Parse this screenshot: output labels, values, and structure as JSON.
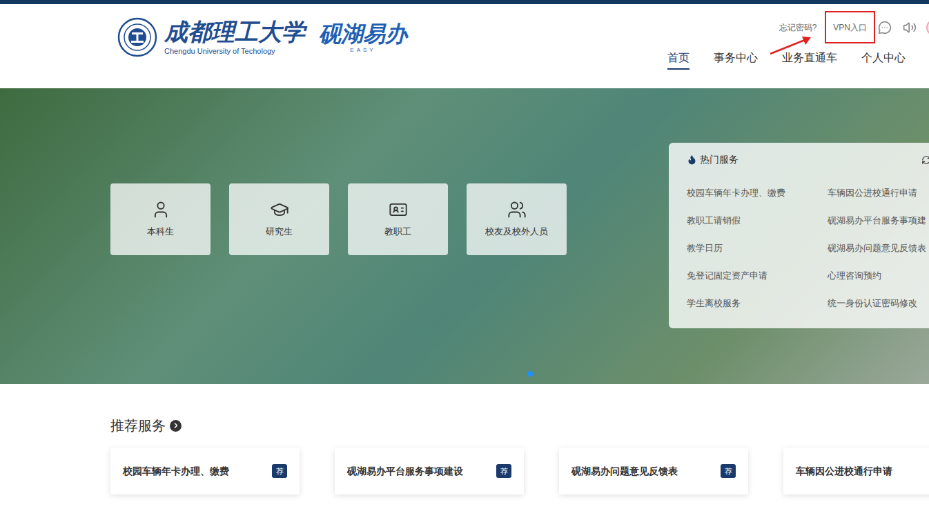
{
  "header": {
    "logo": {
      "school_cn": "成都理工大学",
      "school_en": "Chengdu University of Techology",
      "brand": "砚湖易办",
      "brand_sub": "EASY"
    },
    "top_links": {
      "forgot_password": "忘记密码?",
      "vpn": "VPN入口"
    },
    "nav": [
      {
        "label": "首页",
        "selected": true
      },
      {
        "label": "事务中心",
        "selected": false
      },
      {
        "label": "业务直通车",
        "selected": false
      },
      {
        "label": "个人中心",
        "selected": false
      }
    ]
  },
  "hero": {
    "user_types": [
      {
        "label": "本科生"
      },
      {
        "label": "研究生"
      },
      {
        "label": "教职工"
      },
      {
        "label": "校友及校外人员"
      }
    ],
    "hot_services": {
      "title": "热门服务",
      "items": [
        "校园车辆年卡办理、缴费",
        "车辆因公进校通行申请",
        "教职工请销假",
        "砚湖易办平台服务事项建",
        "教学日历",
        "砚湖易办问题意见反馈表",
        "免登记固定资产申请",
        "心理咨询预约",
        "学生离校服务",
        "统一身份认证密码修改"
      ]
    },
    "carousel_dots": [
      {
        "selected": true
      }
    ]
  },
  "recommended": {
    "title": "推荐服务",
    "cards": [
      {
        "label": "校园车辆年卡办理、缴费",
        "badge": "荐"
      },
      {
        "label": "砚湖易办平台服务事项建设",
        "badge": "荐"
      },
      {
        "label": "砚湖易办问题意见反馈表",
        "badge": "荐"
      },
      {
        "label": "车辆因公进校通行申请",
        "badge": ""
      }
    ]
  }
}
